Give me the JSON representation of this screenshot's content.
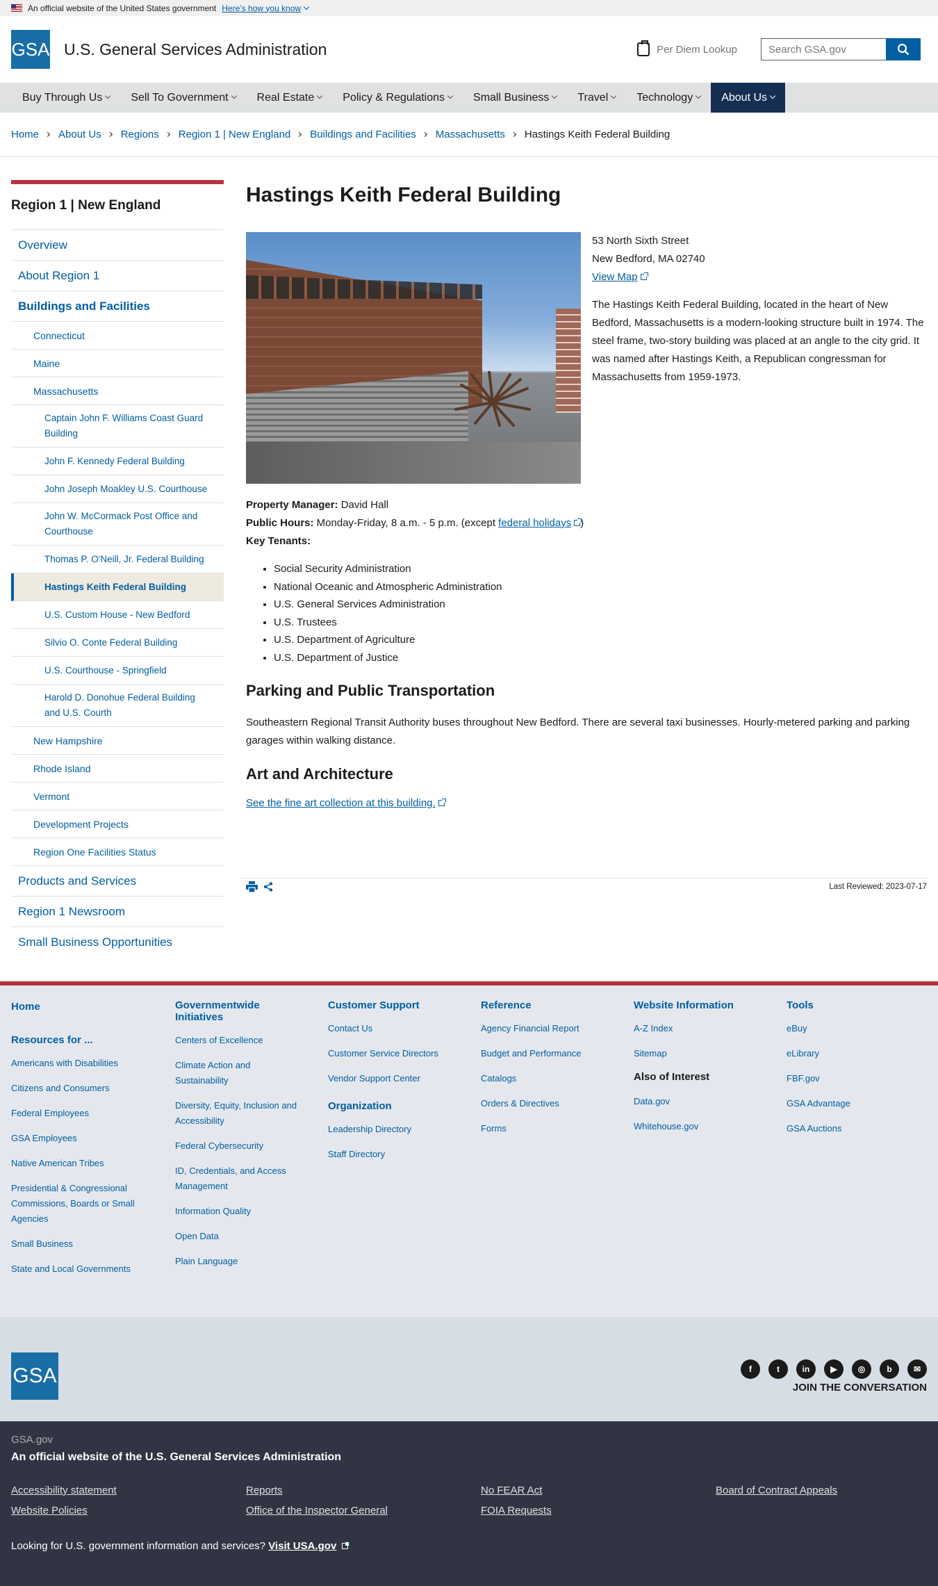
{
  "gov_banner": {
    "text": "An official website of the United States government",
    "link": "Here’s how you know"
  },
  "header": {
    "logo": "GSA",
    "title": "U.S. General Services Administration",
    "per_diem": "Per Diem Lookup",
    "search_placeholder": "Search GSA.gov"
  },
  "nav": [
    {
      "label": "Buy Through Us"
    },
    {
      "label": "Sell To Government"
    },
    {
      "label": "Real Estate"
    },
    {
      "label": "Policy & Regulations"
    },
    {
      "label": "Small Business"
    },
    {
      "label": "Travel"
    },
    {
      "label": "Technology"
    },
    {
      "label": "About Us"
    }
  ],
  "breadcrumb": [
    "Home",
    "About Us",
    "Regions",
    "Region 1 | New England",
    "Buildings and Facilities",
    "Massachusetts",
    "Hastings Keith Federal Building"
  ],
  "sidenav": {
    "title": "Region 1 | New England",
    "items": [
      "Overview",
      "About Region 1",
      "Buildings and Facilities",
      "Connecticut",
      "Maine",
      "Massachusetts",
      "Captain John F. Williams Coast Guard Building",
      "John F. Kennedy Federal Building",
      "John Joseph Moakley U.S. Courthouse",
      "John W. McCormack Post Office and Courthouse",
      "Thomas P. O'Neill, Jr. Federal Building",
      "Hastings Keith Federal Building",
      "U.S. Custom House - New Bedford",
      "Silvio O. Conte Federal Building",
      "U.S. Courthouse - Springfield",
      "Harold D. Donohue Federal Building and U.S. Courth",
      "New Hampshire",
      "Rhode Island",
      "Vermont",
      "Development Projects",
      "Region One Facilities Status",
      "Products and Services",
      "Region 1 Newsroom",
      "Small Business Opportunities"
    ]
  },
  "main": {
    "title": "Hastings Keith Federal Building",
    "address_line1": "53 North Sixth Street",
    "address_line2": "New Bedford, MA 02740",
    "view_map": "View Map",
    "description": "The Hastings Keith Federal Building, located in the heart of New Bedford, Massachusetts is a modern-looking structure built in 1974. The steel frame, two-story building was placed at an angle to the city grid. It was named after Hastings Keith, a Republican congressman for Massachusetts from 1959-1973.",
    "pm_label": "Property Manager:",
    "pm_value": " David Hall",
    "hours_label": "Public Hours:",
    "hours_value": " Monday-Friday, 8 a.m. - 5 p.m. (except ",
    "holidays_link": "federal holidays",
    "hours_close": ")",
    "tenants_label": "Key Tenants:",
    "tenants": [
      "Social Security Administration",
      "National Oceanic and Atmospheric Administration",
      "U.S. General Services Administration",
      "U.S. Trustees",
      "U.S. Department of Agriculture",
      "U.S. Department of Justice"
    ],
    "parking_heading": "Parking and Public Transportation",
    "parking_text": "Southeastern Regional Transit Authority buses throughout New Bedford. There are several taxi businesses. Hourly-metered parking and parking garages within walking distance.",
    "art_heading": "Art and Architecture",
    "art_link": "See the fine art collection at this building.",
    "last_reviewed": "Last Reviewed: 2023-07-17"
  },
  "footer": {
    "col1": {
      "home": "Home",
      "resources": "Resources for ...",
      "links": [
        "Americans with Disabilities",
        "Citizens and Consumers",
        "Federal Employees",
        "GSA Employees",
        "Native American Tribes",
        "Presidential & Congressional Commissions, Boards or Small Agencies",
        "Small Business",
        "State and Local Governments"
      ]
    },
    "col2": {
      "heading": "Governmentwide Initiatives",
      "links": [
        "Centers of Excellence",
        "Climate Action and Sustainability",
        "Diversity, Equity, Inclusion and Accessibility",
        "Federal Cybersecurity",
        "ID, Credentials, and Access Management",
        "Information Quality",
        "Open Data",
        "Plain Language"
      ]
    },
    "col3": {
      "heading": "Customer Support",
      "links": [
        "Contact Us",
        "Customer Service Directors",
        "Vendor Support Center"
      ],
      "heading2": "Organization",
      "links2": [
        "Leadership Directory",
        "Staff Directory"
      ]
    },
    "col4": {
      "heading": "Reference",
      "links": [
        "Agency Financial Report",
        "Budget and Performance",
        "Catalogs",
        "Orders & Directives",
        "Forms"
      ]
    },
    "col5": {
      "heading": "Website Information",
      "links": [
        "A-Z Index",
        "Sitemap"
      ],
      "heading2": "Also of Interest",
      "links2": [
        "Data.gov",
        "Whitehouse.gov"
      ]
    },
    "col6": {
      "heading": "Tools",
      "links": [
        "eBuy",
        "eLibrary",
        "FBF.gov",
        "GSA Advantage",
        "GSA Auctions"
      ]
    },
    "logo": "GSA",
    "join": "JOIN THE CONVERSATION",
    "social": [
      "facebook-icon",
      "twitter-icon",
      "linkedin-icon",
      "youtube-icon",
      "instagram-icon",
      "blog-icon",
      "email-icon"
    ]
  },
  "identifier": {
    "domain": "GSA.gov",
    "official": "An official website of the U.S. General Services Administration",
    "links": [
      "Accessibility statement",
      "Reports",
      "No FEAR Act",
      "Board of Contract Appeals",
      "Website Policies",
      "Office of the Inspector General",
      "FOIA Requests"
    ],
    "usa_text": "Looking for U.S. government information and services? ",
    "usa_link": "Visit USA.gov"
  },
  "colors": {
    "primary": "#005ea2",
    "nav_active": "#162e51",
    "accent_red": "#b8323f",
    "identifier_bg": "#313543"
  }
}
